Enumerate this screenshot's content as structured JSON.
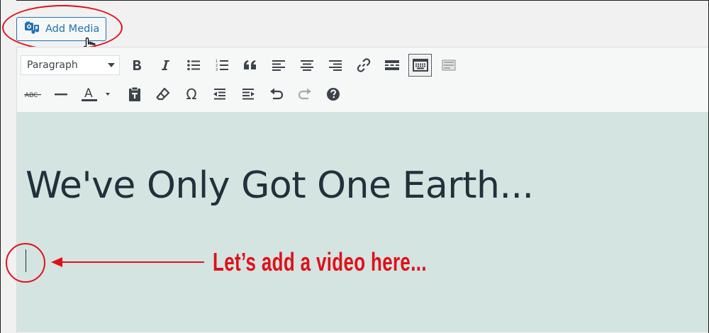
{
  "toolbar": {
    "add_media_label": "Add Media",
    "format_select_value": "Paragraph",
    "strikethrough_label": "ABC",
    "text_color_label": "A",
    "special_char_label": "Ω"
  },
  "content": {
    "heading": "We've Only Got One Earth..."
  },
  "annotation": {
    "callout_text": "Let’s add a video here..."
  },
  "colors": {
    "accent": "#2271b1",
    "annotation_red": "#e0101a",
    "content_bg": "#d4e4e0"
  }
}
